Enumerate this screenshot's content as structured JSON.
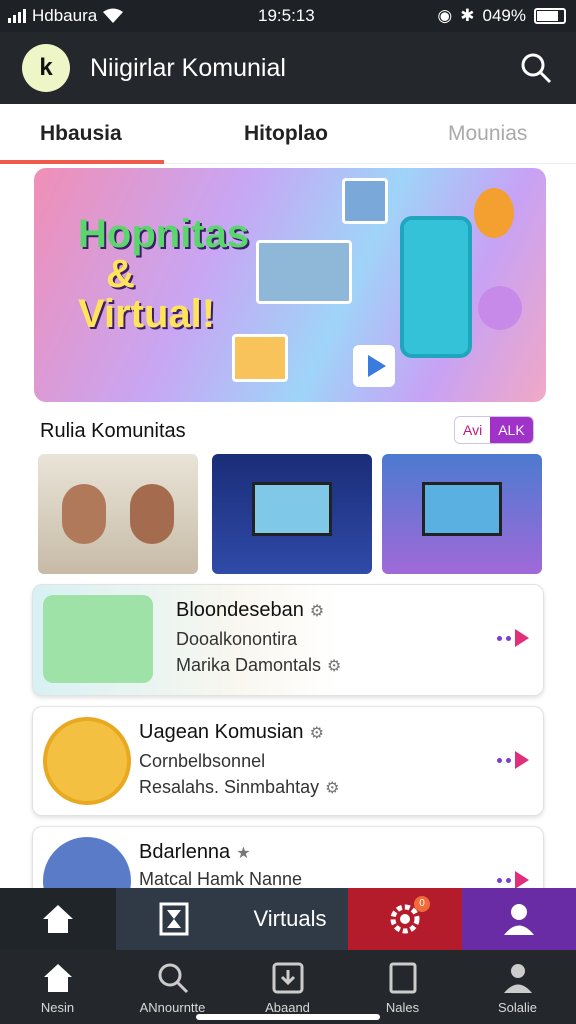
{
  "status": {
    "carrier": "Hdbaura",
    "time": "19:5:13",
    "battery": "049%"
  },
  "appbar": {
    "logo_text": "k",
    "title": "Niigirlar Komunial"
  },
  "tabs": [
    {
      "label": "Hbausia"
    },
    {
      "label": "Hitoplao"
    },
    {
      "label": "Mounias"
    }
  ],
  "hero": {
    "line1": "Hopnitas",
    "amp": "&",
    "line2": "Virtual!"
  },
  "section": {
    "title": "Rulia Komunitas",
    "pill_a": "Avi",
    "pill_b": "ALK"
  },
  "cards": [
    {
      "title": "Bloondeseban",
      "line1": "Dooalkonontira",
      "line2": "Marika Damontals"
    },
    {
      "title": "Uagean Komusian",
      "line1": "Cornbelbsonnel",
      "line2": "Resalahs. Sinmbahtay"
    },
    {
      "title": "Bdarlenna",
      "line1": "Matcal Hamk Nanne"
    }
  ],
  "bottombar": {
    "center_label": "Virtuals",
    "badge": "0"
  },
  "nav": [
    {
      "label": "Nesin",
      "icon": "home-icon"
    },
    {
      "label": "ANnourntte",
      "icon": "search-icon"
    },
    {
      "label": "Abaand",
      "icon": "download-box-icon"
    },
    {
      "label": "Nales",
      "icon": "square-icon"
    },
    {
      "label": "Solalie",
      "icon": "user-icon"
    }
  ],
  "colors": {
    "accent_red": "#f05a4a",
    "accent_purple": "#a032c8",
    "play_pink": "#e0307a"
  }
}
